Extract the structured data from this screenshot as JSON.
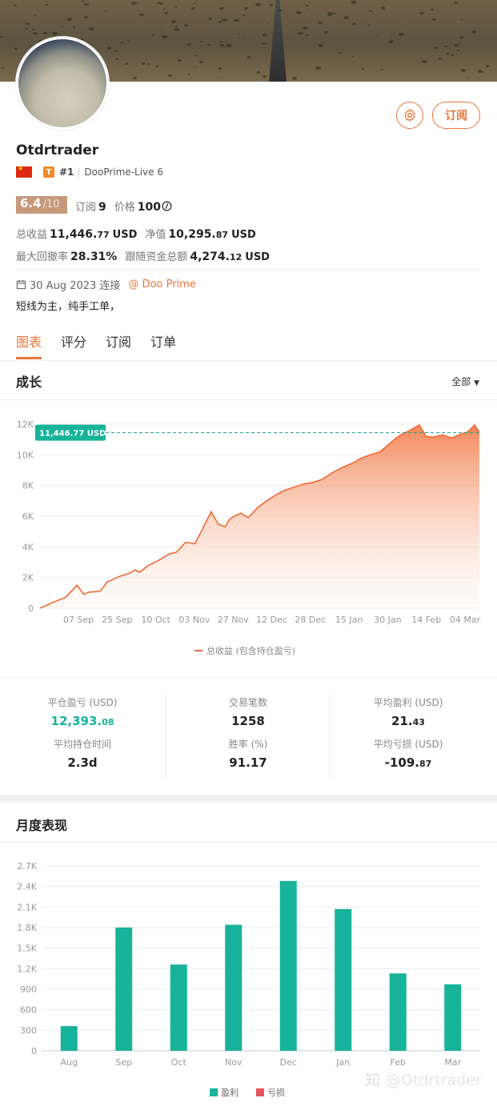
{
  "profile": {
    "name": "Otdrtrader",
    "subscribe_label": "订阅",
    "rank": "#1",
    "server": "DooPrime-Live 6",
    "score": "6.4",
    "score_max": "/10",
    "subscribers_label": "订阅",
    "subscribers": "9",
    "price_label": "价格",
    "price": "100",
    "total_profit_label": "总收益",
    "total_profit_int": "11,446.",
    "total_profit_dec": "77",
    "total_profit_unit": "USD",
    "equity_label": "净值",
    "equity_int": "10,295.",
    "equity_dec": "87",
    "equity_unit": "USD",
    "max_drawdown_label": "最大回撤率",
    "max_drawdown": "28.31%",
    "follow_funds_label": "跟随资金总额",
    "follow_funds_int": "4,274.",
    "follow_funds_dec": "12",
    "follow_funds_unit": "USD",
    "connected_date": "30 Aug 2023 连接",
    "broker": "@ Doo Prime",
    "bio": "短线为主，纯手工单，"
  },
  "tabs": [
    "图表",
    "评分",
    "订阅",
    "订单"
  ],
  "growth_section": {
    "title": "成长",
    "filter": "全部"
  },
  "monthly_section": {
    "title": "月度表现"
  },
  "stats": [
    {
      "label": "平仓盈亏 (USD)",
      "int": "12,393.",
      "dec": "08",
      "green": true
    },
    {
      "label": "交易笔数",
      "int": "1258",
      "dec": ""
    },
    {
      "label": "平均盈利 (USD)",
      "int": "21.",
      "dec": "43"
    },
    {
      "label": "平均持仓时间",
      "int": "2.3d",
      "dec": ""
    },
    {
      "label": "胜率 (%)",
      "int": "91.17",
      "dec": ""
    },
    {
      "label": "平均亏损 (USD)",
      "int": "-109.",
      "dec": "87"
    }
  ],
  "watermark": "@Otdrtrader",
  "colors": {
    "accent": "#e8743b",
    "profit": "#17b39a",
    "loss": "#e8555f"
  },
  "chart_data": [
    {
      "type": "area",
      "title": "",
      "series": [
        {
          "name": "总收益 (包含持仓盈亏)"
        }
      ],
      "x": [
        "2023-08-30",
        "2023-09-05",
        "2023-09-10",
        "2023-09-15",
        "2023-09-18",
        "2023-09-20",
        "2023-09-25",
        "2023-09-28",
        "2023-10-03",
        "2023-10-08",
        "2023-10-10",
        "2023-10-12",
        "2023-10-16",
        "2023-10-20",
        "2023-10-25",
        "2023-10-28",
        "2023-11-01",
        "2023-11-05",
        "2023-11-08",
        "2023-11-12",
        "2023-11-15",
        "2023-11-18",
        "2023-11-20",
        "2023-11-22",
        "2023-11-25",
        "2023-11-28",
        "2023-12-02",
        "2023-12-06",
        "2023-12-10",
        "2023-12-14",
        "2023-12-18",
        "2023-12-22",
        "2023-12-26",
        "2023-12-30",
        "2024-01-03",
        "2024-01-08",
        "2024-01-12",
        "2024-01-16",
        "2024-01-20",
        "2024-01-24",
        "2024-01-28",
        "2024-01-31",
        "2024-02-02",
        "2024-02-06",
        "2024-02-10",
        "2024-02-13",
        "2024-02-16",
        "2024-02-20",
        "2024-02-24",
        "2024-02-28",
        "2024-03-02",
        "2024-03-05",
        "2024-03-07"
      ],
      "y": [
        0,
        400,
        700,
        1500,
        900,
        1050,
        1100,
        1700,
        2050,
        2300,
        2500,
        2350,
        2800,
        3100,
        3550,
        3650,
        4300,
        4200,
        5100,
        6300,
        5500,
        5300,
        5800,
        6000,
        6200,
        5900,
        6550,
        7000,
        7400,
        7700,
        7900,
        8100,
        8200,
        8400,
        8800,
        9200,
        9450,
        9800,
        10000,
        10200,
        10700,
        11100,
        11300,
        11600,
        11950,
        11200,
        11150,
        11300,
        11100,
        11350,
        11500,
        11950,
        11446.77
      ],
      "x_ticks": [
        "07 Sep",
        "25 Sep",
        "10 Oct",
        "03 Nov",
        "27 Nov",
        "12 Dec",
        "28 Dec",
        "15 Jan",
        "30 Jan",
        "14 Feb",
        "04 Mar"
      ],
      "y_ticks": [
        "0",
        "2K",
        "4K",
        "6K",
        "8K",
        "10K",
        "12K"
      ],
      "ylim": [
        0,
        12000
      ],
      "current_label": "11,446.77 USD",
      "grid": true,
      "legend": "bottom"
    },
    {
      "type": "bar",
      "title": "",
      "categories": [
        "Aug",
        "Sep",
        "Oct",
        "Nov",
        "Dec",
        "Jan",
        "Feb",
        "Mar"
      ],
      "series": [
        {
          "name": "盈利",
          "values": [
            360,
            1800,
            1260,
            1840,
            2480,
            2070,
            1130,
            970
          ]
        },
        {
          "name": "亏损",
          "values": [
            0,
            0,
            0,
            0,
            0,
            0,
            0,
            0
          ]
        }
      ],
      "y_ticks": [
        "0",
        "300",
        "600",
        "900",
        "1.2K",
        "1.5K",
        "1.8K",
        "2.1K",
        "2.4K",
        "2.7K"
      ],
      "ylim": [
        0,
        2700
      ],
      "grid": true,
      "legend": "bottom"
    }
  ]
}
